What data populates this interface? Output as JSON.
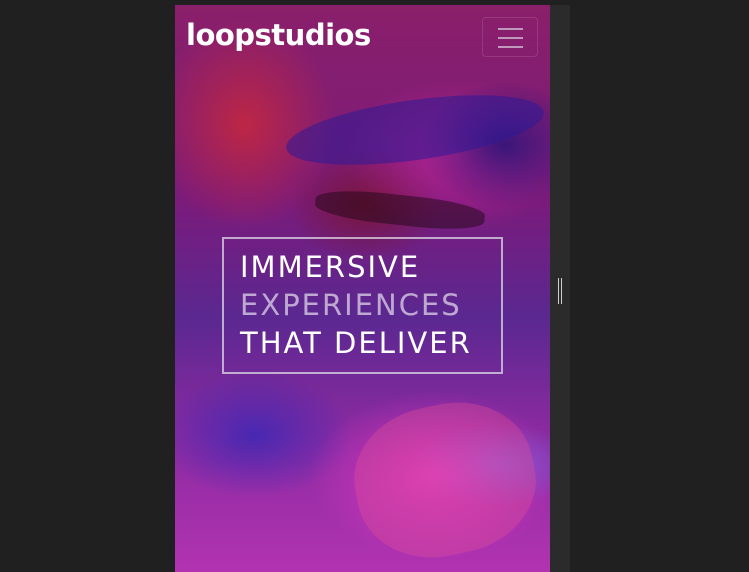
{
  "navbar": {
    "logo_text": "loopstudios",
    "menu_icon": "hamburger-menu-icon"
  },
  "hero": {
    "line1": "IMMERSIVE",
    "line2": "EXPERIENCES",
    "line3": "THAT DELIVER"
  },
  "device_preview": {
    "resize_handle_icon": "resize-handle-icon"
  },
  "colors": {
    "page_background": "#202020",
    "text": "#ffffff",
    "hero_border": "#e6e6eb"
  }
}
